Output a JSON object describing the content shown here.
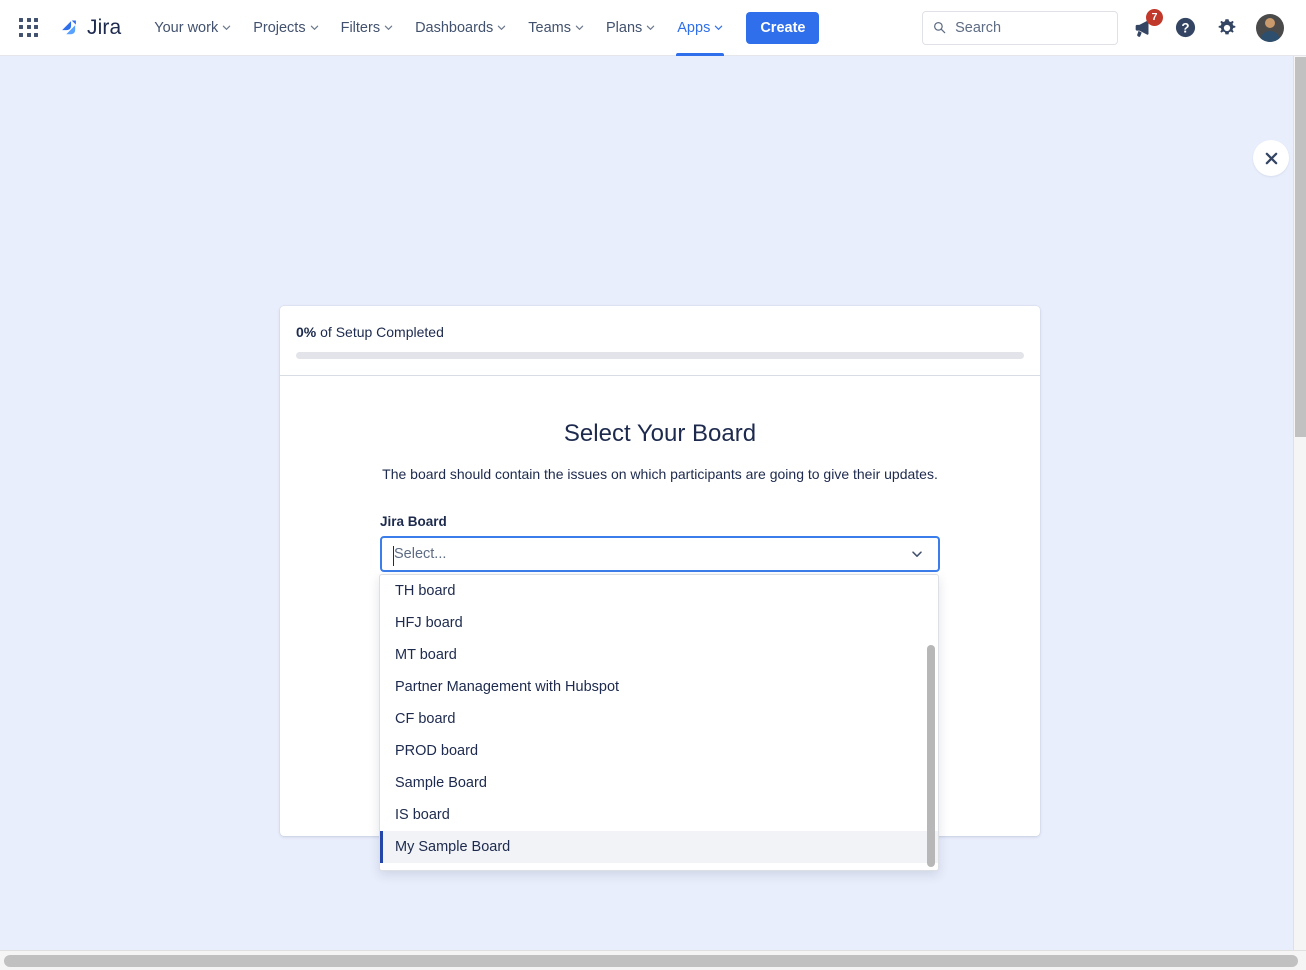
{
  "nav": {
    "app_switcher_icon": "grid-apps-icon",
    "brand": "Jira",
    "items": [
      {
        "label": "Your work",
        "has_caret": true,
        "active": false
      },
      {
        "label": "Projects",
        "has_caret": true,
        "active": false
      },
      {
        "label": "Filters",
        "has_caret": true,
        "active": false
      },
      {
        "label": "Dashboards",
        "has_caret": true,
        "active": false
      },
      {
        "label": "Teams",
        "has_caret": true,
        "active": false
      },
      {
        "label": "Plans",
        "has_caret": true,
        "active": false
      },
      {
        "label": "Apps",
        "has_caret": true,
        "active": true
      }
    ],
    "create_label": "Create",
    "search_placeholder": "Search",
    "search_value": "",
    "notifications_badge": "7",
    "notifications_icon": "announcement-bell-icon",
    "help_icon": "help-question-icon",
    "settings_icon": "gear-icon",
    "avatar_icon": "user-avatar"
  },
  "modal": {
    "close_icon": "close-x-icon",
    "progress": {
      "percent": "0%",
      "suffix": " of Setup Completed",
      "value": 0
    },
    "title": "Select Your Board",
    "subtitle": "The board should contain the issues on which participants are going to give their updates.",
    "field": {
      "label": "Jira Board",
      "placeholder": "Select...",
      "value": "",
      "caret_icon": "chevron-down-icon"
    }
  },
  "dropdown": {
    "options": [
      {
        "label": "TH board",
        "selected": false
      },
      {
        "label": "HFJ board",
        "selected": false
      },
      {
        "label": "MT board",
        "selected": false
      },
      {
        "label": "Partner Management with Hubspot",
        "selected": false
      },
      {
        "label": "CF board",
        "selected": false
      },
      {
        "label": "PROD board",
        "selected": false
      },
      {
        "label": "Sample Board",
        "selected": false
      },
      {
        "label": "IS board",
        "selected": false
      },
      {
        "label": "My Sample Board",
        "selected": true
      }
    ]
  },
  "colors": {
    "accent_blue": "#2f6feb",
    "page_background": "#e9eefc",
    "text_dark": "#1d2a4d",
    "badge_red": "#c0392b"
  }
}
